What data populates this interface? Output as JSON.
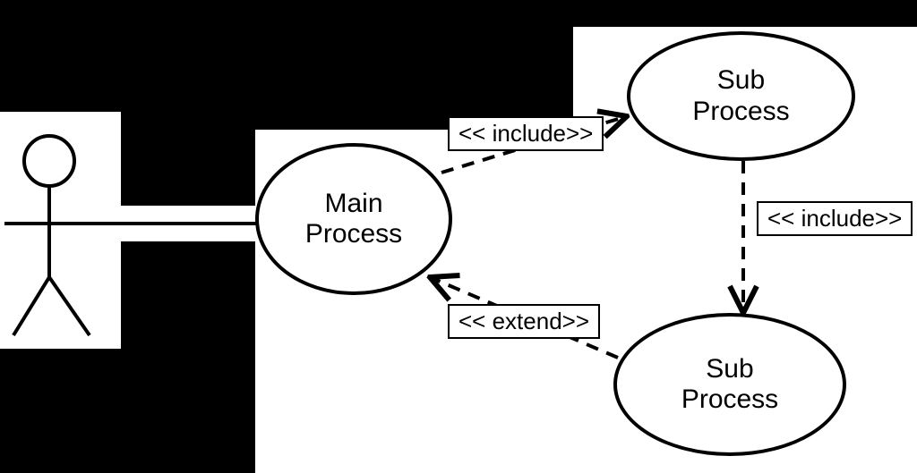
{
  "diagram": {
    "actor": "Actor",
    "usecases": {
      "main": "Main\nProcess",
      "sub1": "Sub\nProcess",
      "sub2": "Sub\nProcess"
    },
    "relations": {
      "include1": "<< include>>",
      "include2": "<< include>>",
      "extend": "<< extend>>"
    }
  }
}
